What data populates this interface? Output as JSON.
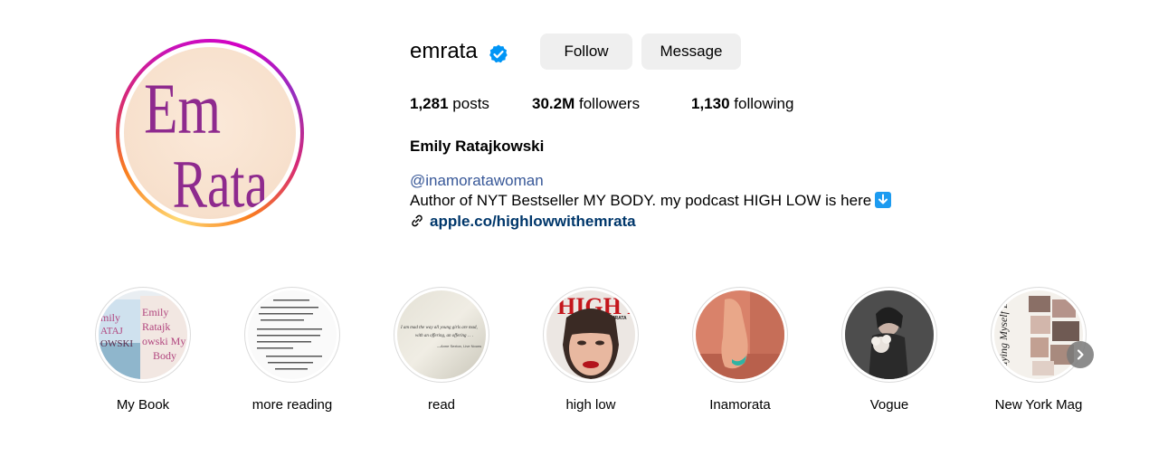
{
  "profile": {
    "username": "emrata",
    "avatar_text_line1": "Em",
    "avatar_text_line2": "Rata",
    "verified_icon": "verified-badge-icon",
    "follow_label": "Follow",
    "message_label": "Message",
    "stats": {
      "posts_count": "1,281",
      "posts_label": "posts",
      "followers_count": "30.2M",
      "followers_label": "followers",
      "following_count": "1,130",
      "following_label": "following"
    },
    "full_name": "Emily Ratajkowski",
    "mention": "@inamoratawoman",
    "bio": "Author of NYT Bestseller MY BODY. my podcast HIGH LOW is here",
    "link_icon": "link-icon",
    "link": "apple.co/highlowwithemrata"
  },
  "highlights": [
    {
      "label": "My Book"
    },
    {
      "label": "more reading"
    },
    {
      "label": "read"
    },
    {
      "label": "high low"
    },
    {
      "label": "Inamorata"
    },
    {
      "label": "Vogue"
    },
    {
      "label": "New York Mag"
    }
  ],
  "highlight_cover_text": {
    "book_title_1": "Emily",
    "book_title_2": "Ratajk",
    "book_title_3": "owski My",
    "book_title_4": "Body",
    "read_quote_1": "I am mad the way all young girls are mad,",
    "read_quote_2": "with an offering, an offering . . .",
    "read_quote_3": "—Anne Sexton, Live Nouns",
    "high_low_mag": "HIGH LOW",
    "high_low_brand": "EMRATA",
    "nymag_cover": "Buying Myself Back"
  },
  "colors": {
    "accent_link": "#00376b",
    "mention": "#385898",
    "button_bg": "#efefef",
    "verified": "#0095f6",
    "avatar_text": "#8e2a8e"
  },
  "icons": {
    "next": "chevron-right-icon",
    "emoji": "down-arrow-icon"
  }
}
